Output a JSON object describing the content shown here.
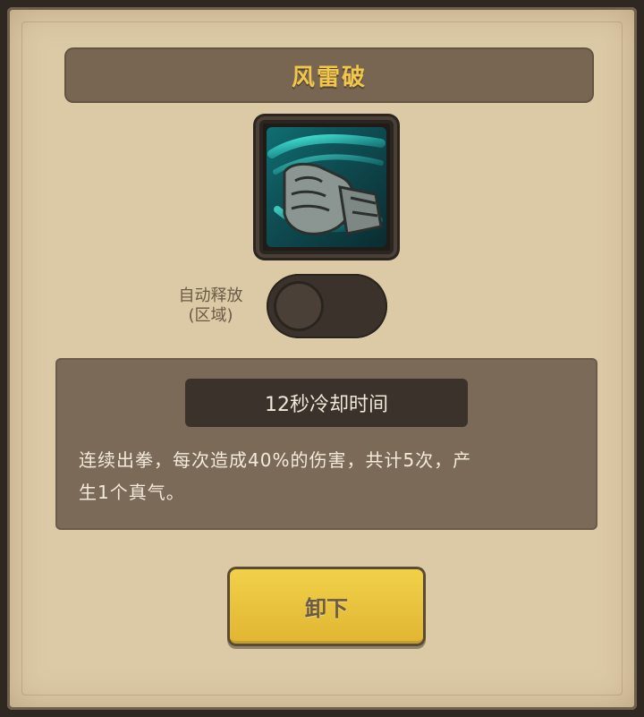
{
  "dialog": {
    "title": "风雷破",
    "skill_icon": "fist-icon",
    "auto_cast_label": "自动释放",
    "auto_cast_sub_label": "(区域)",
    "auto_cast_enabled": false,
    "cooldown_text": "12秒冷却时间",
    "description_line1": "连续出拳，每次造成40%的伤害，共计5次，产",
    "description_line2": "生1个真气。",
    "unequip_button": "卸下"
  },
  "colors": {
    "title_gold": "#f2c64a",
    "panel": "#dcc9a6",
    "dark_box": "#7a6a57",
    "button_yellow": "#e0b431"
  }
}
